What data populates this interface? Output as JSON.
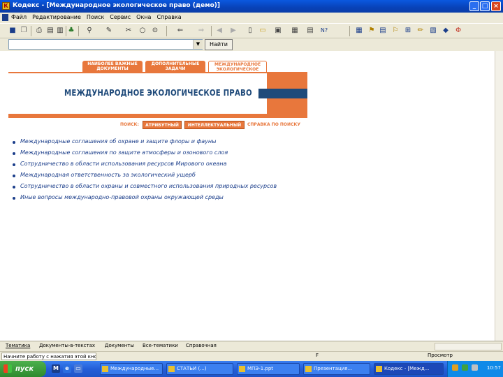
{
  "window": {
    "title": "Кодекс - [Международное экологическое право (демо)]",
    "minimize": "_",
    "maximize": "□",
    "close": "×"
  },
  "menu": [
    "Файл",
    "Редактирование",
    "Поиск",
    "Сервис",
    "Окна",
    "Справка"
  ],
  "search": {
    "value": "",
    "button": "Найти"
  },
  "tabs": [
    "НАИБОЛЕЕ ВАЖНЫЕ ДОКУМЕНТЫ",
    "ДОПОЛНИТЕЛЬНЫЕ ЗАДАЧИ",
    "МЕЖДУНАРОДНОЕ ЭКОЛОГИЧЕСКОЕ ПРАВО"
  ],
  "banner_title": "МЕЖДУНАРОДНОЕ ЭКОЛОГИЧЕСКОЕ ПРАВО",
  "search_panel": {
    "label": "ПОИСК:",
    "attr_button": "АТРИБУТНЫЙ",
    "intel_button": "ИНТЕЛЛЕКТУАЛЬНЫЙ",
    "help": "СПРАВКА ПО ПОИСКУ"
  },
  "topics": [
    "Международные соглашения об охране и защите флоры и фауны",
    "Международные соглашения по защите атмосферы и озонового слоя",
    "Сотрудничество в области использования ресурсов Мирового океана",
    "Международная ответственность за экологический ущерб",
    "Сотрудничество в области охраны и совместного использования природных ресурсов",
    "Иные вопросы международно-правовой охраны окружающей среды"
  ],
  "bottom_tabs": [
    "Тематика",
    "Документы-в-текстах",
    "Документы",
    "Все-тематики",
    "Справочная"
  ],
  "status": {
    "text": "Начните работу с нажатия этой кнопки",
    "f": "F",
    "view": "Просмотр"
  },
  "taskbar": {
    "start": "пуск",
    "tasks": [
      "Международные...",
      "СТАТЬИ (...)",
      "МПЭ-1.ppt",
      "Презентация...",
      "Кодекс - [Межд..."
    ],
    "clock": "10:57"
  }
}
